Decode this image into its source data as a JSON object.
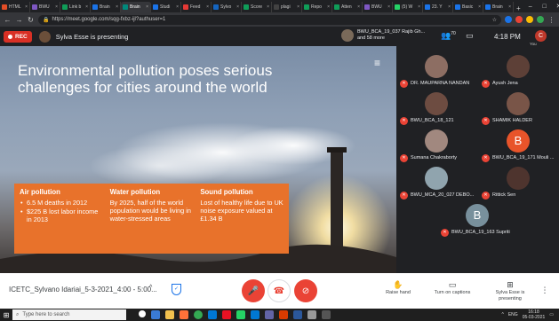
{
  "browser": {
    "tabs": [
      {
        "label": "HTML",
        "color": "#e44d26"
      },
      {
        "label": "BWU",
        "color": "#7e57c2"
      },
      {
        "label": "Link b",
        "color": "#0f9d58"
      },
      {
        "label": "Brain",
        "color": "#1a73e8"
      },
      {
        "label": "Brain",
        "color": "#00897b",
        "active": true
      },
      {
        "label": "Studi",
        "color": "#1a73e8"
      },
      {
        "label": "Feed",
        "color": "#e53935"
      },
      {
        "label": "Sylvo",
        "color": "#1565c0"
      },
      {
        "label": "Score",
        "color": "#0f9d58"
      },
      {
        "label": "plagi",
        "color": "#424242"
      },
      {
        "label": "Repo",
        "color": "#0f9d58"
      },
      {
        "label": "Atten",
        "color": "#0f9d58"
      },
      {
        "label": "BWU",
        "color": "#7e57c2"
      },
      {
        "label": "(5) W",
        "color": "#25d366"
      },
      {
        "label": "23. Y",
        "color": "#1a73e8"
      },
      {
        "label": "Basic",
        "color": "#1a73e8"
      },
      {
        "label": "Brain",
        "color": "#1a73e8"
      }
    ],
    "new_tab": "+",
    "url": "https://meet.google.com/sqg-fxbz-ijl?authuser=1"
  },
  "meet_top": {
    "rec_label": "REC",
    "presenting_text": "Sylva Esse is presenting",
    "pinned_line1": "BWU_BCA_19_037 Rajib Gh...",
    "pinned_line2": "and 58 more",
    "people_count": "70",
    "time": "4:18 PM",
    "you_initial": "C",
    "you_label": "You"
  },
  "slide": {
    "title": "Environmental pollution poses serious challenges for cities around the world",
    "logo": "≡",
    "columns": [
      {
        "heading": "Air pollution",
        "bullets": [
          "6.5 M deaths in 2012",
          "$225 B lost labor income in 2013"
        ]
      },
      {
        "heading": "Water pollution",
        "text": "By 2025, half of the world population would be living in water-stressed areas"
      },
      {
        "heading": "Sound pollution",
        "text": "Lost of healthy life due to UK noise exposure valued at £1.34 B"
      }
    ]
  },
  "participants": [
    {
      "name": "DR. MAUPARNA NANDAN",
      "color": "#8d6e63"
    },
    {
      "name": "Ayush Jena",
      "color": "#5d4037"
    },
    {
      "name": "BWU_BCA_18_121",
      "color": "#6d4c41"
    },
    {
      "name": "SHAMIK HALDER",
      "color": "#795548"
    },
    {
      "name": "Sumana Chakraborty",
      "color": "#a1887f"
    },
    {
      "name": "BWU_BCA_19_171 Mouli ...",
      "color": "#e8542a",
      "letter": "B"
    },
    {
      "name": "BWU_MCA_20_027 DEBO...",
      "color": "#90a4ae"
    },
    {
      "name": "Rittick Sen",
      "color": "#4e342e"
    },
    {
      "name": "BWU_BCA_19_163 Supriti",
      "color": "#78909c",
      "letter": "B"
    }
  ],
  "meet_bottom": {
    "meeting_title": "ICETC_Sylvano Idariai_5-3-2021_4:00 - 5:00...",
    "raise_hand": "Raise hand",
    "captions": "Turn on captions",
    "presenting": "Sylva Esse is presenting"
  },
  "taskbar": {
    "search_placeholder": "Type here to search",
    "lang": "ENG",
    "clock_time": "16:18",
    "clock_date": "05-03-2021"
  }
}
